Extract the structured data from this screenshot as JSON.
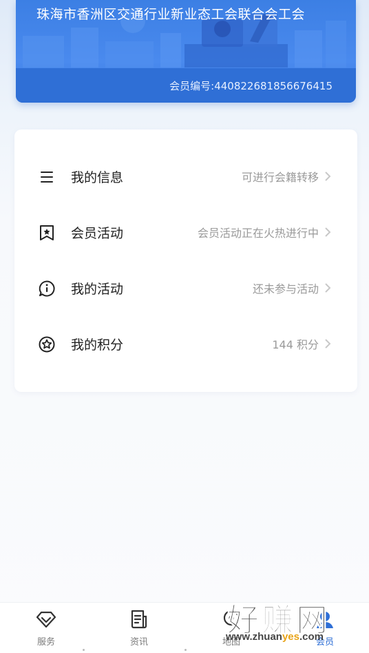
{
  "card": {
    "union_name": "珠海市香洲区交通行业新业态工会联合会工会",
    "member_label": "会员编号:",
    "member_no": "440822681856676415"
  },
  "menu": [
    {
      "icon": "list-lines-icon",
      "label": "我的信息",
      "hint": "可进行会籍转移"
    },
    {
      "icon": "bookmark-star-icon",
      "label": "会员活动",
      "hint": "会员活动正在火热进行中"
    },
    {
      "icon": "info-bubble-icon",
      "label": "我的活动",
      "hint": "还未参与活动"
    },
    {
      "icon": "star-circle-icon",
      "label": "我的积分",
      "hint": "144 积分"
    }
  ],
  "tabs": [
    {
      "icon": "heart-diamond-icon",
      "label": "服务",
      "active": false
    },
    {
      "icon": "news-document-icon",
      "label": "资讯",
      "active": false
    },
    {
      "icon": "map-pin-icon",
      "label": "地图",
      "active": false
    },
    {
      "icon": "member-user-icon",
      "label": "会员",
      "active": true
    }
  ],
  "watermark": {
    "main": "好赚网",
    "site_pre": "www.zhuan",
    "site_accent": "yes",
    "site_post": ".com"
  },
  "colors": {
    "accent": "#2f6fd6",
    "card": "#3c7fe4",
    "hint": "#9a9a9a"
  }
}
